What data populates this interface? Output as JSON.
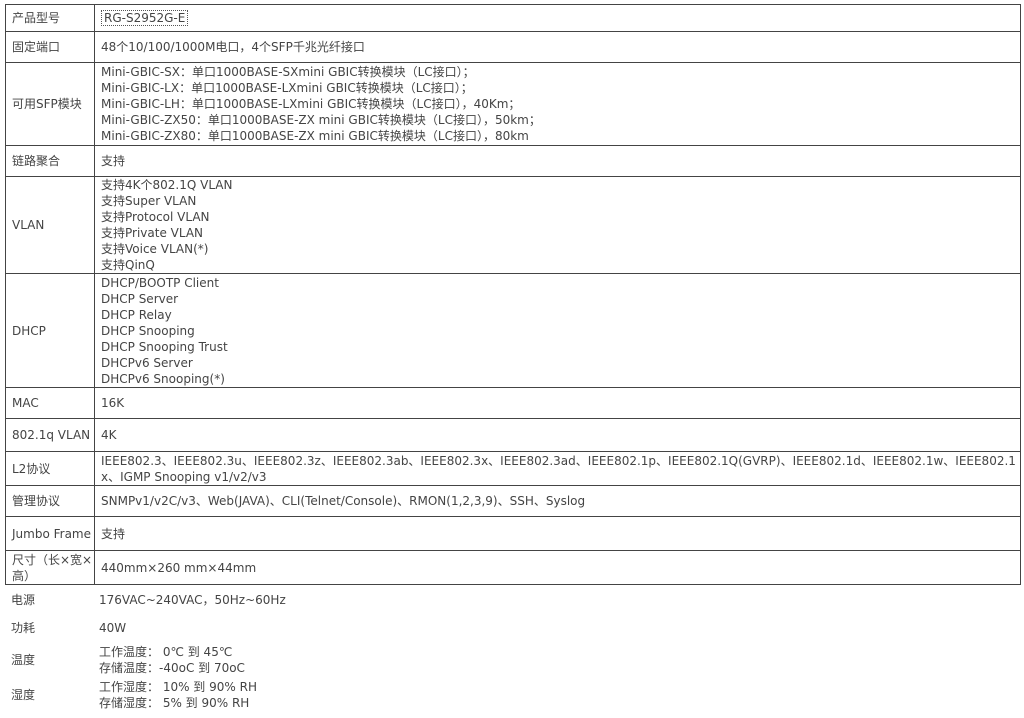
{
  "specs": {
    "model": {
      "label": "产品型号",
      "value": "RG-S2952G-E"
    },
    "fixed_ports": {
      "label": "固定端口",
      "value": "48个10/100/1000M电口，4个SFP千兆光纤接口"
    },
    "sfp_modules": {
      "label": "可用SFP模块",
      "lines": [
        "Mini-GBIC-SX：单口1000BASE-SXmini GBIC转换模块（LC接口）；",
        "Mini-GBIC-LX：单口1000BASE-LXmini GBIC转换模块（LC接口）；",
        "Mini-GBIC-LH：单口1000BASE-LXmini GBIC转换模块（LC接口），40Km；",
        "Mini-GBIC-ZX50：单口1000BASE-ZX mini GBIC转换模块（LC接口），50km；",
        "Mini-GBIC-ZX80：单口1000BASE-ZX mini GBIC转换模块（LC接口），80km"
      ]
    },
    "link_aggregation": {
      "label": "链路聚合",
      "value": "支持"
    },
    "vlan": {
      "label": "VLAN",
      "lines": [
        "支持4K个802.1Q VLAN",
        "支持Super VLAN",
        "支持Protocol VLAN",
        "支持Private VLAN",
        "支持Voice VLAN(*)",
        "支持QinQ"
      ]
    },
    "dhcp": {
      "label": "DHCP",
      "lines": [
        "DHCP/BOOTP Client",
        "DHCP Server",
        "DHCP Relay",
        "DHCP Snooping",
        "DHCP Snooping Trust",
        "DHCPv6 Server",
        "DHCPv6 Snooping(*)"
      ]
    },
    "mac": {
      "label": "MAC",
      "value": "16K"
    },
    "vlan_8021q": {
      "label": "802.1q VLAN",
      "value": "4K"
    },
    "l2_protocols": {
      "label": "L2协议",
      "value": "IEEE802.3、IEEE802.3u、IEEE802.3z、IEEE802.3ab、IEEE802.3x、IEEE802.3ad、IEEE802.1p、IEEE802.1Q(GVRP)、IEEE802.1d、IEEE802.1w、IEEE802.1x、IGMP Snooping v1/v2/v3"
    },
    "management": {
      "label": "管理协议",
      "value": "SNMPv1/v2C/v3、Web(JAVA)、CLI(Telnet/Console)、RMON(1,2,3,9)、SSH、Syslog"
    },
    "jumbo_frame": {
      "label": "Jumbo Frame",
      "value": "支持"
    },
    "dimensions": {
      "label": "尺寸（长×宽×高）",
      "value": "440mm×260 mm×44mm"
    }
  },
  "extra": {
    "power": {
      "label": "电源",
      "value": "176VAC~240VAC，50Hz~60Hz"
    },
    "consumption": {
      "label": "功耗",
      "value": "40W"
    },
    "temperature": {
      "label": "温度",
      "lines": [
        "工作温度： 0℃ 到 45℃",
        "存储温度：-40oC 到 70oC"
      ]
    },
    "humidity": {
      "label": "湿度",
      "lines": [
        "工作湿度： 10% 到 90% RH",
        "存储湿度： 5% 到 90% RH"
      ]
    }
  }
}
